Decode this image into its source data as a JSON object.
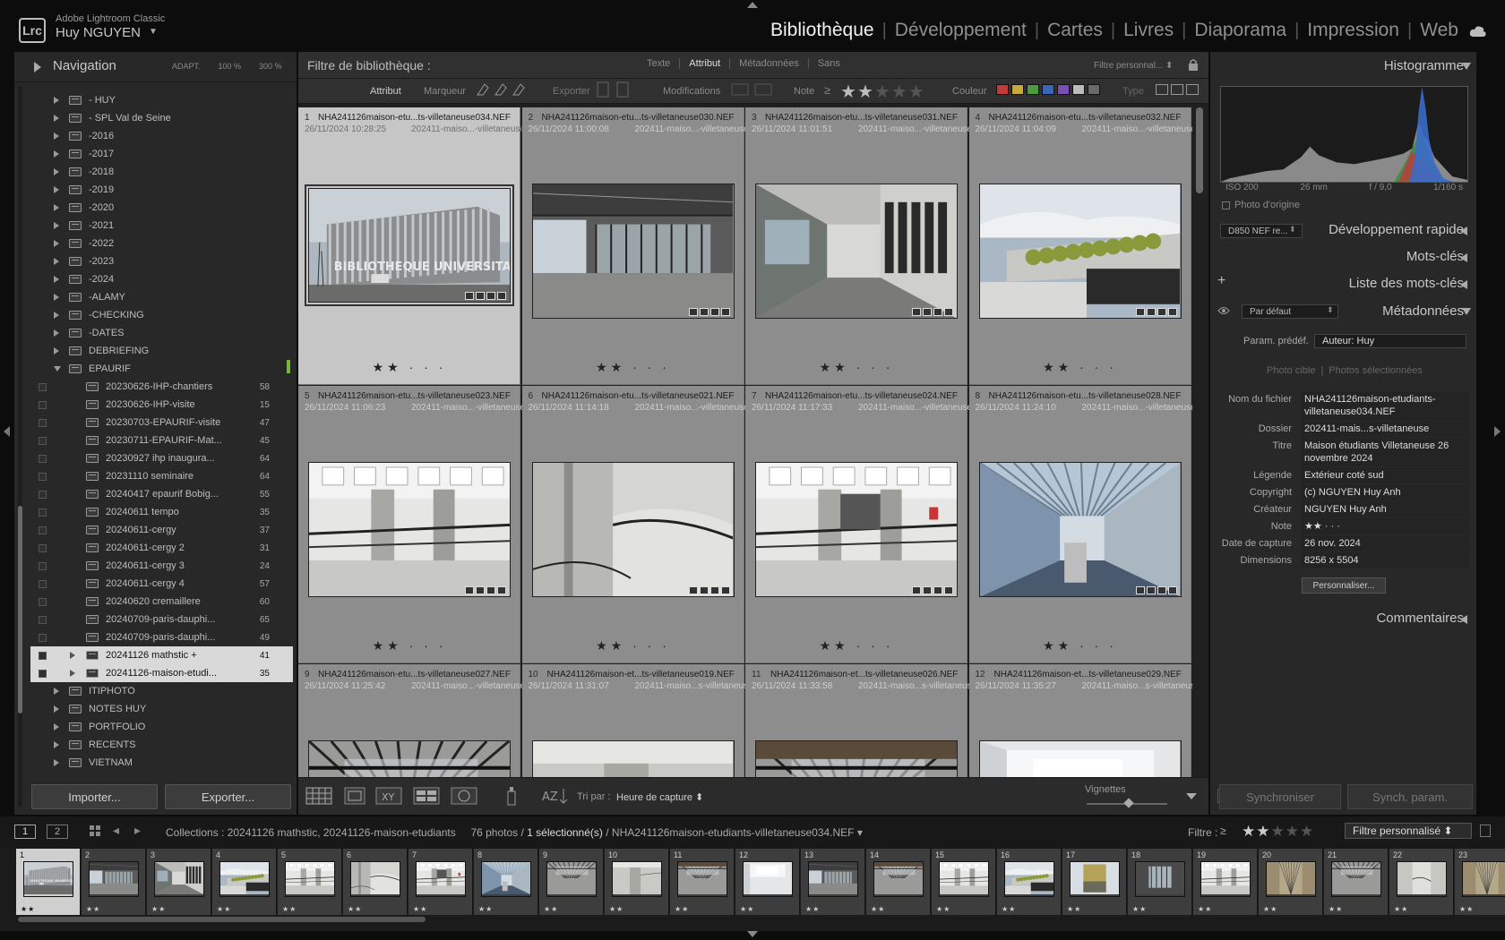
{
  "app": {
    "brand_logo": "Lrc",
    "name": "Adobe Lightroom Classic",
    "user": "Huy NGUYEN",
    "user_caret": "▼"
  },
  "modules": [
    {
      "label": "Bibliothèque",
      "active": true
    },
    {
      "label": "Développement",
      "active": false
    },
    {
      "label": "Cartes",
      "active": false
    },
    {
      "label": "Livres",
      "active": false
    },
    {
      "label": "Diaporama",
      "active": false
    },
    {
      "label": "Impression",
      "active": false
    },
    {
      "label": "Web",
      "active": false
    }
  ],
  "navigator": {
    "title": "Navigation",
    "opts": [
      "ADAPT.",
      "100 %",
      "300 %"
    ]
  },
  "collections": [
    {
      "label": "- HUY",
      "level": 0,
      "type": "set"
    },
    {
      "label": "- SPL Val de Seine",
      "level": 0,
      "type": "set"
    },
    {
      "label": "-2016",
      "level": 0,
      "type": "set"
    },
    {
      "label": "-2017",
      "level": 0,
      "type": "set"
    },
    {
      "label": "-2018",
      "level": 0,
      "type": "set"
    },
    {
      "label": "-2019",
      "level": 0,
      "type": "set"
    },
    {
      "label": "-2020",
      "level": 0,
      "type": "set"
    },
    {
      "label": "-2021",
      "level": 0,
      "type": "set"
    },
    {
      "label": "-2022",
      "level": 0,
      "type": "set"
    },
    {
      "label": "-2023",
      "level": 0,
      "type": "set"
    },
    {
      "label": "-2024",
      "level": 0,
      "type": "set"
    },
    {
      "label": "-ALAMY",
      "level": 0,
      "type": "set"
    },
    {
      "label": "-CHECKING",
      "level": 0,
      "type": "set"
    },
    {
      "label": "-DATES",
      "level": 0,
      "type": "set"
    },
    {
      "label": "DEBRIEFING",
      "level": 0,
      "type": "set"
    },
    {
      "label": "EPAURIF",
      "level": 0,
      "type": "set",
      "open": true
    },
    {
      "label": "20230626-IHP-chantiers",
      "level": 1,
      "count": "58"
    },
    {
      "label": "20230626-IHP-visite",
      "level": 1,
      "count": "15"
    },
    {
      "label": "20230703-EPAURIF-visite",
      "level": 1,
      "count": "47"
    },
    {
      "label": "20230711-EPAURIF-Mat...",
      "level": 1,
      "count": "45"
    },
    {
      "label": "20230927 ihp inaugura...",
      "level": 1,
      "count": "64"
    },
    {
      "label": "20231110 seminaire",
      "level": 1,
      "count": "64"
    },
    {
      "label": "20240417 epaurif Bobig...",
      "level": 1,
      "count": "55"
    },
    {
      "label": "20240611 tempo",
      "level": 1,
      "count": "35"
    },
    {
      "label": "20240611-cergy",
      "level": 1,
      "count": "37"
    },
    {
      "label": "20240611-cergy 2",
      "level": 1,
      "count": "31"
    },
    {
      "label": "20240611-cergy 3",
      "level": 1,
      "count": "24"
    },
    {
      "label": "20240611-cergy 4",
      "level": 1,
      "count": "57"
    },
    {
      "label": "20240620 cremaillere",
      "level": 1,
      "count": "60"
    },
    {
      "label": "20240709-paris-dauphi...",
      "level": 1,
      "count": "65"
    },
    {
      "label": "20240709-paris-dauphi...",
      "level": 1,
      "count": "49"
    },
    {
      "label": "20241126 mathstic +",
      "level": 1,
      "count": "41",
      "selected": true
    },
    {
      "label": "20241126-maison-etudi...",
      "level": 1,
      "count": "35",
      "selected": true
    },
    {
      "label": "ITIPHOTO",
      "level": 0,
      "type": "set"
    },
    {
      "label": "NOTES HUY",
      "level": 0,
      "type": "set"
    },
    {
      "label": "PORTFOLIO",
      "level": 0,
      "type": "set"
    },
    {
      "label": "RECENTS",
      "level": 0,
      "type": "set"
    },
    {
      "label": "VIETNAM",
      "level": 0,
      "type": "set"
    }
  ],
  "left_buttons": {
    "import": "Importer...",
    "export": "Exporter..."
  },
  "filter": {
    "title": "Filtre de bibliothèque :",
    "tabs": [
      "Texte",
      "Attribut",
      "Métadonnées",
      "Sans"
    ],
    "active_tab": "Attribut",
    "custom": "Filtre personnal... ⬍",
    "attr_label": "Attribut",
    "marquer": "Marqueur",
    "exporter": "Exporter",
    "modifications": "Modifications",
    "note": "Note",
    "note_op": "≥",
    "couleur": "Couleur",
    "type": "Type",
    "colors": [
      "#c23b3b",
      "#c9a93a",
      "#4e9a3f",
      "#3b66b8",
      "#7a4fb5",
      "#bcbcbc",
      "#6a6a6a"
    ]
  },
  "grid": [
    {
      "num": "1",
      "file": "NHA241126maison-etu...ts-villetaneuse034.NEF",
      "date": "26/11/2024 10:28:25",
      "folder": "202411-maiso...-villetaneuse",
      "stars": "★★ · · ·",
      "scene": "facade",
      "selected": true
    },
    {
      "num": "2",
      "file": "NHA241126maison-etu...ts-villetaneuse030.NEF",
      "date": "26/11/2024 11:00:08",
      "folder": "202411-maiso...-villetaneuse",
      "stars": "★★ · · ·",
      "scene": "interior-window"
    },
    {
      "num": "3",
      "file": "NHA241126maison-etu...ts-villetaneuse031.NEF",
      "date": "26/11/2024 11:01:51",
      "folder": "202411-maiso...-villetaneuse",
      "stars": "★★ · · ·",
      "scene": "corridor-window"
    },
    {
      "num": "4",
      "file": "NHA241126maison-etu...ts-villetaneuse032.NEF",
      "date": "26/11/2024 11:04:09",
      "folder": "202411-maiso...-villetaneuse",
      "stars": "★★ · · ·",
      "scene": "terrace"
    },
    {
      "num": "5",
      "file": "NHA241126maison-etu...ts-villetaneuse023.NEF",
      "date": "26/11/2024 11:06:23",
      "folder": "202411-maiso...-villetaneuse",
      "stars": "★★ · · ·",
      "scene": "atrium"
    },
    {
      "num": "6",
      "file": "NHA241126maison-etu...ts-villetaneuse021.NEF",
      "date": "26/11/2024 11:14:18",
      "folder": "202411-maiso...-villetaneuse",
      "stars": "★★ · · ·",
      "scene": "ramp"
    },
    {
      "num": "7",
      "file": "NHA241126maison-etu...ts-villetaneuse024.NEF",
      "date": "26/11/2024 11:17:33",
      "folder": "202411-maiso...-villetaneuse",
      "stars": "★★ · · ·",
      "scene": "atrium2"
    },
    {
      "num": "8",
      "file": "NHA241126maison-etu...ts-villetaneuse028.NEF",
      "date": "26/11/2024 11:24:10",
      "folder": "202411-maiso...-villetaneuse",
      "stars": "★★ · · ·",
      "scene": "hallway"
    },
    {
      "num": "9",
      "file": "NHA241126maison-etu...ts-villetaneuse027.NEF",
      "date": "26/11/2024 11:25:42",
      "folder": "202411-maiso...-villetaneuse",
      "stars": "",
      "scene": "ceiling"
    },
    {
      "num": "10",
      "file": "NHA241126maison-et...ts-villetaneuse019.NEF",
      "date": "26/11/2024 11:31:07",
      "folder": "202411-maiso...s-villetaneuse",
      "stars": "",
      "scene": "column"
    },
    {
      "num": "11",
      "file": "NHA241126maison-et...ts-villetaneuse026.NEF",
      "date": "26/11/2024 11:33:58",
      "folder": "202411-maiso...s-villetaneuse",
      "stars": "",
      "scene": "ceiling2"
    },
    {
      "num": "12",
      "file": "NHA241126maison-et...ts-villetaneuse029.NEF",
      "date": "26/11/2024 11:35:27",
      "folder": "202411-maiso...s-villetaneuse",
      "stars": "",
      "scene": "white"
    }
  ],
  "toolbar": {
    "sort_label": "Tri par :",
    "sort_value": "Heure de capture ⬍",
    "vignettes": "Vignettes"
  },
  "right": {
    "histogram": "Histogramme",
    "histo_info": [
      "ISO 200",
      "26 mm",
      "f / 9,0",
      "1/160 s"
    ],
    "photo_origine": "Photo d'origine",
    "quick_preset": "D850 NEF re...",
    "quick_dev": "Développement rapide",
    "keywords": "Mots-clés",
    "keyword_list": "Liste des mots-clés",
    "metadata_preset": "Par défaut",
    "metadata": "Métadonnées",
    "param_label": "Param. prédéf.",
    "param_value": "Auteur: Huy",
    "target_photo": "Photo cible",
    "selected_photos": "Photos sélectionnées",
    "fields": [
      {
        "k": "Nom du fichier",
        "v": "NHA241126maison-etudiants-villetaneuse034.NEF"
      },
      {
        "k": "Dossier",
        "v": "202411-mais...s-villetaneuse"
      },
      {
        "k": "Titre",
        "v": "Maison étudiants Villetaneuse 26 novembre 2024"
      },
      {
        "k": "Légende",
        "v": "Extérieur coté sud"
      },
      {
        "k": "Copyright",
        "v": "(c) NGUYEN Huy Anh"
      },
      {
        "k": "Créateur",
        "v": "NGUYEN Huy Anh"
      },
      {
        "k": "Note",
        "v": "★★ · · ·"
      },
      {
        "k": "Date de capture",
        "v": "26 nov. 2024"
      },
      {
        "k": "Dimensions",
        "v": "8256 x 5504"
      }
    ],
    "customize": "Personnaliser...",
    "comments": "Commentaires",
    "sync": "Synchroniser",
    "sync_param": "Synch. param."
  },
  "status": {
    "page1": "1",
    "page2": "2",
    "source": "Collections : 20241126 mathstic, 20241126-maison-etudiants",
    "count": "76 photos /",
    "selected": "1 sélectionné(s)",
    "file": "/ NHA241126maison-etudiants-villetaneuse034.NEF ▾",
    "filter_label": "Filtre :",
    "filter_op": "≥",
    "filter_select": "Filtre personnalisé ⬍"
  },
  "filmstrip": [
    {
      "n": "1",
      "scene": "facade",
      "sel": true
    },
    {
      "n": "2",
      "scene": "interior-window"
    },
    {
      "n": "3",
      "scene": "corridor-window"
    },
    {
      "n": "4",
      "scene": "terrace"
    },
    {
      "n": "5",
      "scene": "atrium"
    },
    {
      "n": "6",
      "scene": "ramp"
    },
    {
      "n": "7",
      "scene": "atrium2"
    },
    {
      "n": "8",
      "scene": "hallway"
    },
    {
      "n": "9",
      "scene": "ceiling"
    },
    {
      "n": "10",
      "scene": "column"
    },
    {
      "n": "11",
      "scene": "ceiling2"
    },
    {
      "n": "12",
      "scene": "white"
    },
    {
      "n": "13",
      "scene": "interior-window"
    },
    {
      "n": "14",
      "scene": "ceiling2"
    },
    {
      "n": "15",
      "scene": "atrium"
    },
    {
      "n": "16",
      "scene": "terrace"
    },
    {
      "n": "17",
      "scene": "terrace-v"
    },
    {
      "n": "18",
      "scene": "interior-v"
    },
    {
      "n": "19",
      "scene": "atrium"
    },
    {
      "n": "20",
      "scene": "ceiling-v"
    },
    {
      "n": "21",
      "scene": "ceiling"
    },
    {
      "n": "22",
      "scene": "ramp-v"
    },
    {
      "n": "23",
      "scene": "ceiling-v"
    }
  ]
}
